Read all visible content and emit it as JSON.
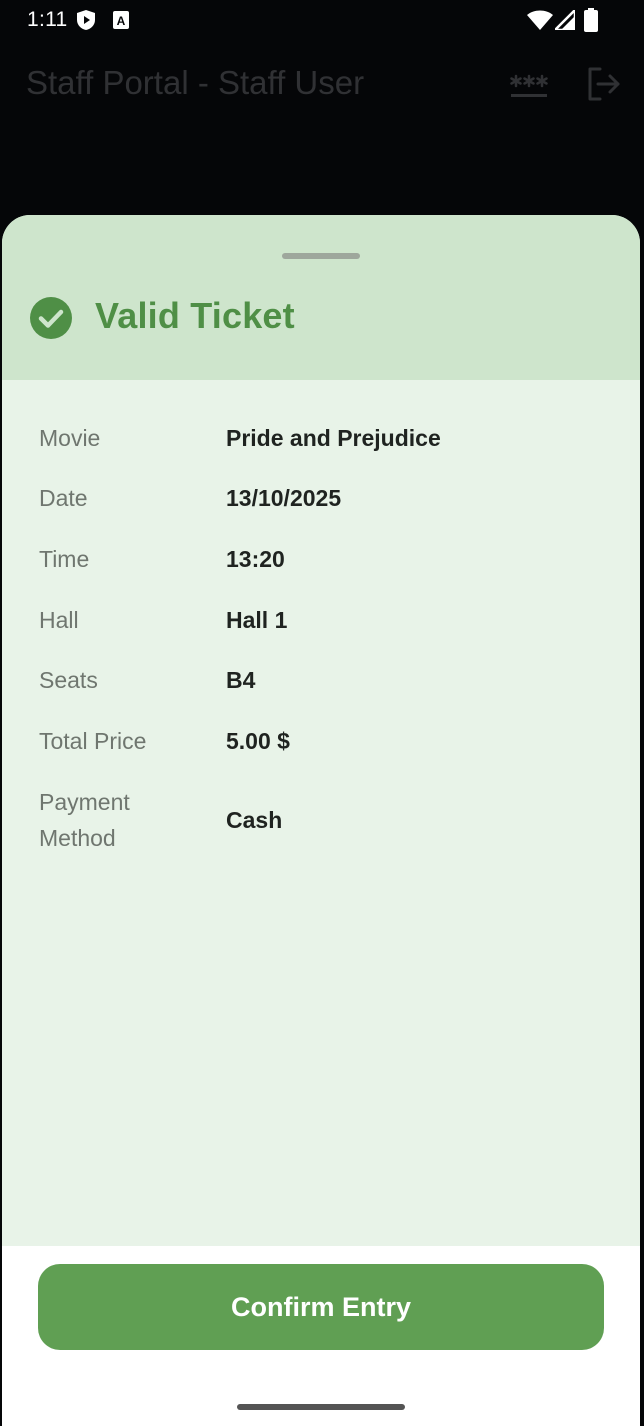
{
  "status_bar": {
    "time": "1:11",
    "icons": [
      "play-protect-icon",
      "autofill-icon",
      "wifi-icon",
      "signal-icon",
      "battery-icon"
    ]
  },
  "app_bar": {
    "title": "Staff Portal - Staff User",
    "actions": [
      "password-icon",
      "logout-icon"
    ]
  },
  "sheet": {
    "title": "Valid Ticket",
    "status_icon": "check-circle-icon",
    "details": [
      {
        "label": "Movie",
        "value": "Pride and Prejudice"
      },
      {
        "label": "Date",
        "value": "13/10/2025"
      },
      {
        "label": "Time",
        "value": "13:20"
      },
      {
        "label": "Hall",
        "value": "Hall 1"
      },
      {
        "label": "Seats",
        "value": "B4"
      },
      {
        "label": "Total Price",
        "value": "5.00 $"
      },
      {
        "label": "Payment Method",
        "value": "Cash"
      }
    ]
  },
  "footer": {
    "confirm_label": "Confirm Entry"
  },
  "colors": {
    "accent": "#609f53",
    "header_bg": "#cee5cc",
    "sheet_bg": "#e8f3e8",
    "title_green": "#4f8f46"
  }
}
